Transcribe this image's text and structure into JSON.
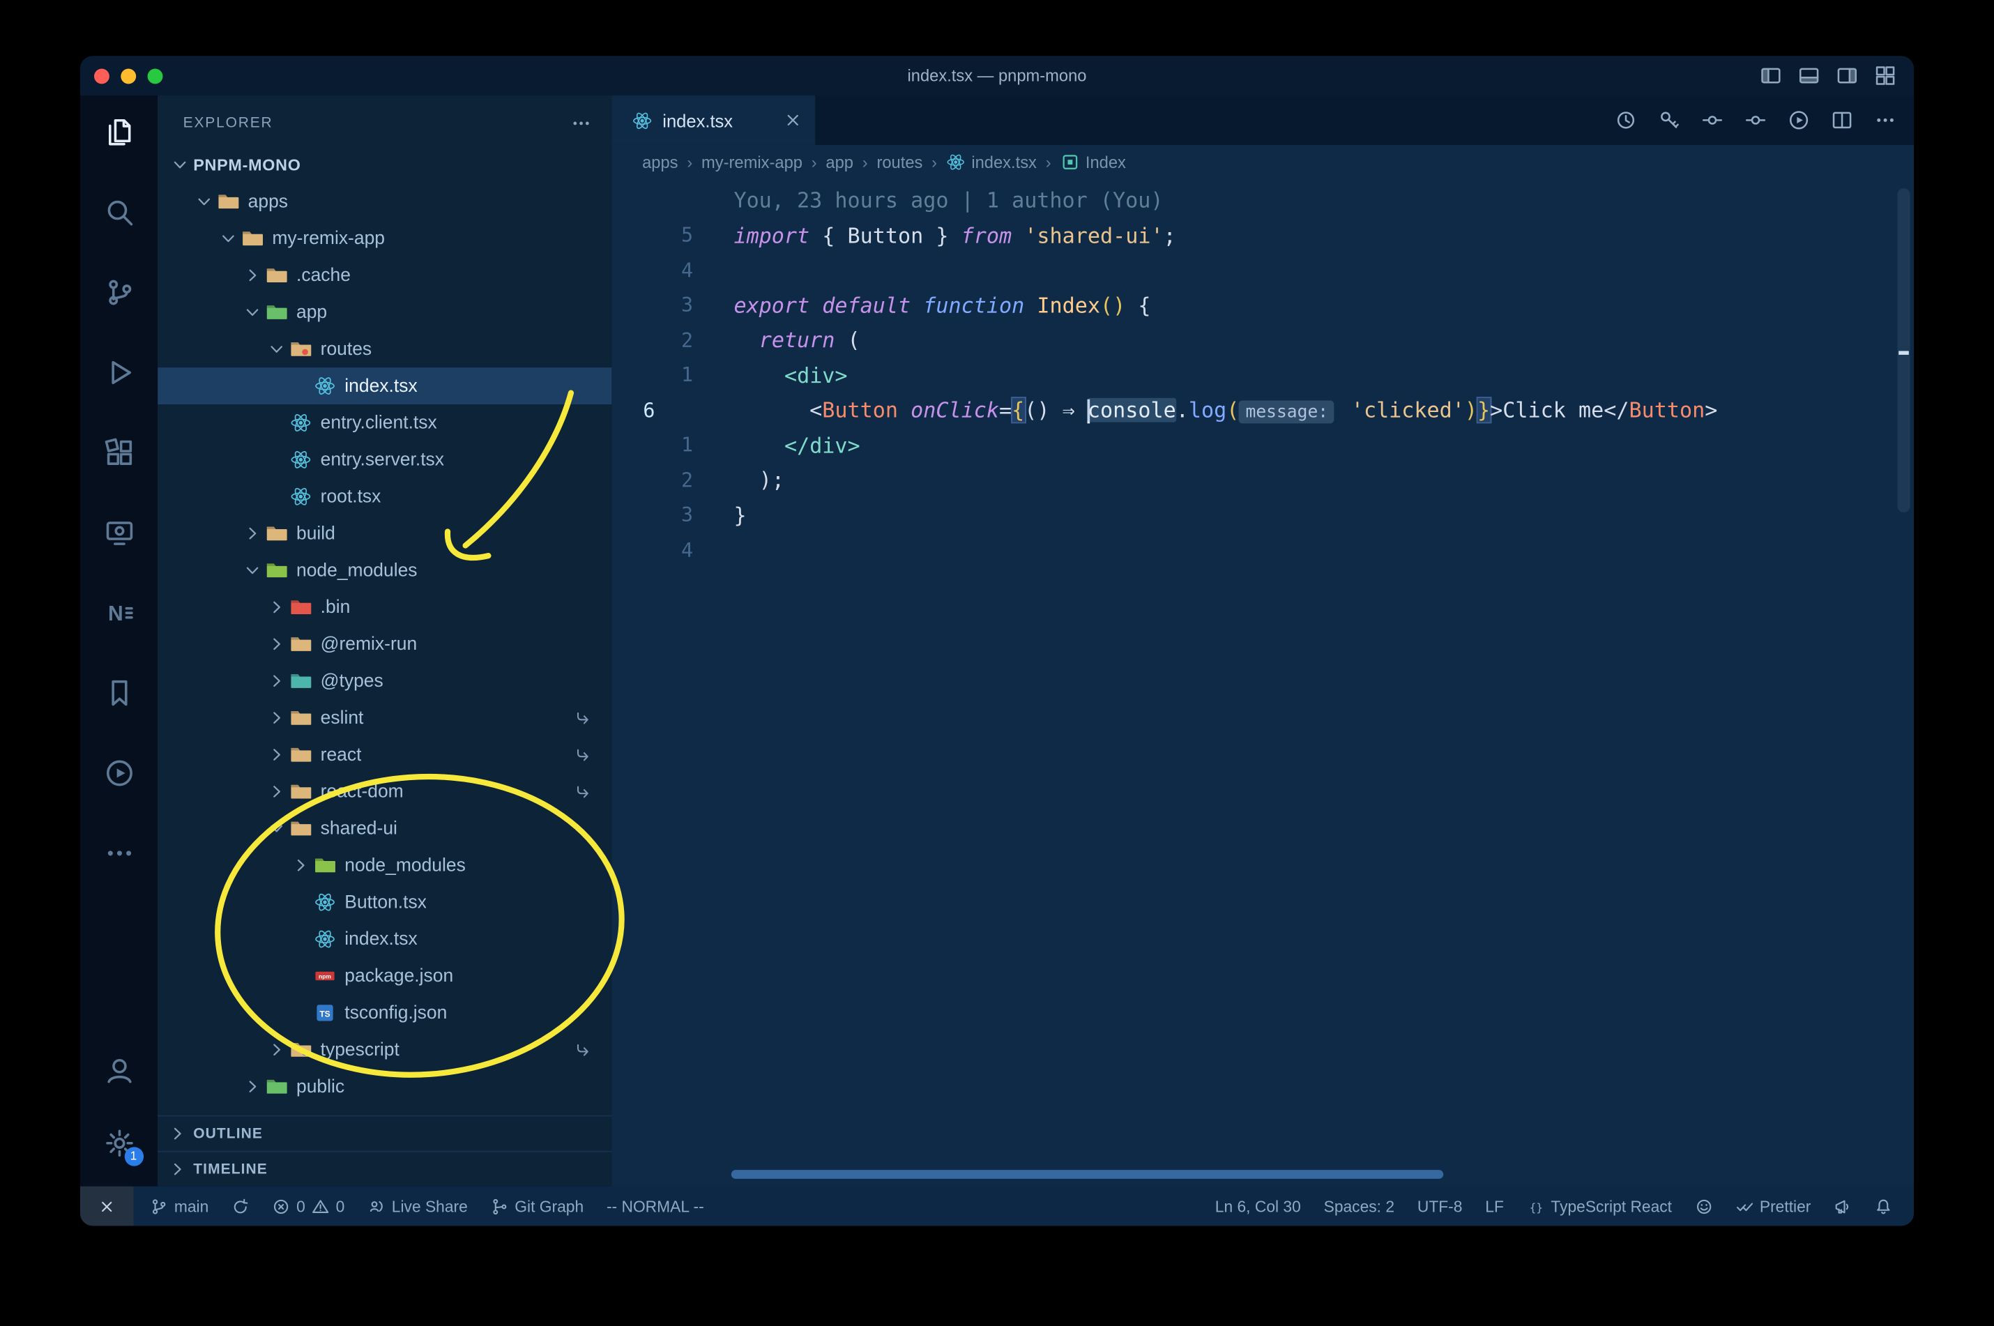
{
  "window": {
    "title": "index.tsx — pnpm-mono"
  },
  "titlebar": {
    "layout_controls": [
      {
        "name": "toggle-primary-sidebar",
        "icon": "layout-sidebar-left"
      },
      {
        "name": "toggle-panel",
        "icon": "layout-panel"
      },
      {
        "name": "toggle-secondary-sidebar",
        "icon": "layout-sidebar-right"
      },
      {
        "name": "customize-layout",
        "icon": "layout-grid"
      }
    ]
  },
  "activity_bar": {
    "top": [
      {
        "name": "explorer",
        "icon": "files",
        "active": true
      },
      {
        "name": "search",
        "icon": "search"
      },
      {
        "name": "source-control",
        "icon": "source-control"
      },
      {
        "name": "run-and-debug",
        "icon": "debug"
      },
      {
        "name": "extensions",
        "icon": "extensions"
      },
      {
        "name": "remote-explorer",
        "icon": "remote"
      },
      {
        "name": "nx-console",
        "icon": "nx"
      },
      {
        "name": "bookmarks",
        "icon": "bookmark"
      },
      {
        "name": "live-share",
        "icon": "play-circle"
      },
      {
        "name": "additional-views",
        "icon": "ellipsis"
      }
    ],
    "bottom": [
      {
        "name": "accounts",
        "icon": "account"
      },
      {
        "name": "settings",
        "icon": "gear",
        "badge": "1"
      }
    ]
  },
  "sidebar": {
    "header": "EXPLORER",
    "tree": [
      {
        "label": "PNPM-MONO",
        "depth": 0,
        "kind": "root",
        "expanded": true
      },
      {
        "label": "apps",
        "depth": 1,
        "kind": "folder",
        "color": "#dcb67a",
        "expanded": true
      },
      {
        "label": "my-remix-app",
        "depth": 2,
        "kind": "folder",
        "color": "#dcb67a",
        "expanded": true
      },
      {
        "label": ".cache",
        "depth": 3,
        "kind": "folder",
        "color": "#dcb67a",
        "expanded": false
      },
      {
        "label": "app",
        "depth": 3,
        "kind": "folder",
        "color": "#6abf69",
        "expanded": true
      },
      {
        "label": "routes",
        "depth": 4,
        "kind": "folder",
        "color": "#dcb67a",
        "dot": "#e45649",
        "expanded": true
      },
      {
        "label": "index.tsx",
        "depth": 5,
        "kind": "file",
        "icon": "react",
        "selected": true
      },
      {
        "label": "entry.client.tsx",
        "depth": 4,
        "kind": "file",
        "icon": "react"
      },
      {
        "label": "entry.server.tsx",
        "depth": 4,
        "kind": "file",
        "icon": "react"
      },
      {
        "label": "root.tsx",
        "depth": 4,
        "kind": "file",
        "icon": "react"
      },
      {
        "label": "build",
        "depth": 3,
        "kind": "folder",
        "color": "#dcb67a",
        "expanded": false
      },
      {
        "label": "node_modules",
        "depth": 3,
        "kind": "folder",
        "color": "#8bc34a",
        "expanded": true
      },
      {
        "label": ".bin",
        "depth": 4,
        "kind": "folder",
        "color": "#e45649",
        "expanded": false
      },
      {
        "label": "@remix-run",
        "depth": 4,
        "kind": "folder",
        "color": "#dcb67a",
        "expanded": false
      },
      {
        "label": "@types",
        "depth": 4,
        "kind": "folder",
        "color": "#4db6ac",
        "expanded": false
      },
      {
        "label": "eslint",
        "depth": 4,
        "kind": "folder",
        "color": "#dcb67a",
        "expanded": false,
        "symlink": true
      },
      {
        "label": "react",
        "depth": 4,
        "kind": "folder",
        "color": "#dcb67a",
        "expanded": false,
        "symlink": true
      },
      {
        "label": "react-dom",
        "depth": 4,
        "kind": "folder",
        "color": "#dcb67a",
        "expanded": false,
        "symlink": true
      },
      {
        "label": "shared-ui",
        "depth": 4,
        "kind": "folder",
        "color": "#dcb67a",
        "expanded": true
      },
      {
        "label": "node_modules",
        "depth": 5,
        "kind": "folder",
        "color": "#8bc34a",
        "expanded": false
      },
      {
        "label": "Button.tsx",
        "depth": 5,
        "kind": "file",
        "icon": "react"
      },
      {
        "label": "index.tsx",
        "depth": 5,
        "kind": "file",
        "icon": "react"
      },
      {
        "label": "package.json",
        "depth": 5,
        "kind": "file",
        "icon": "npm"
      },
      {
        "label": "tsconfig.json",
        "depth": 5,
        "kind": "file",
        "icon": "ts"
      },
      {
        "label": "typescript",
        "depth": 4,
        "kind": "folder",
        "color": "#dcb67a",
        "dot": "#3178c6",
        "expanded": false,
        "symlink": true
      },
      {
        "label": "public",
        "depth": 3,
        "kind": "folder",
        "color": "#6abf69",
        "expanded": false
      }
    ],
    "sections": [
      {
        "label": "OUTLINE"
      },
      {
        "label": "TIMELINE"
      }
    ]
  },
  "editor": {
    "tab": {
      "label": "index.tsx",
      "icon": "react"
    },
    "actions": [
      {
        "name": "local-history",
        "icon": "history"
      },
      {
        "name": "gitlens-annotations",
        "icon": "key"
      },
      {
        "name": "toggle-blame",
        "icon": "eye-line"
      },
      {
        "name": "toggle-heatmap",
        "icon": "eye-line"
      },
      {
        "name": "run-file",
        "icon": "run-circle"
      },
      {
        "name": "split-editor",
        "icon": "split"
      },
      {
        "name": "more-actions",
        "icon": "ellipsis"
      }
    ],
    "breadcrumbs": [
      {
        "label": "apps"
      },
      {
        "label": "my-remix-app"
      },
      {
        "label": "app"
      },
      {
        "label": "routes"
      },
      {
        "label": "index.tsx",
        "icon": "react"
      },
      {
        "label": "Index",
        "icon": "symbol"
      }
    ],
    "code_lines": [
      {
        "num": "",
        "cls": "blame",
        "tokens": [
          [
            "You, 23 hours ago | 1 author (You)",
            "dim"
          ]
        ]
      },
      {
        "num": "5",
        "tokens": [
          [
            "import",
            "kw"
          ],
          [
            " ",
            "pln"
          ],
          [
            "{",
            "pnc"
          ],
          [
            " ",
            "pln"
          ],
          [
            "Button",
            "var"
          ],
          [
            " ",
            "pln"
          ],
          [
            "}",
            "pnc"
          ],
          [
            " ",
            "pln"
          ],
          [
            "from",
            "kw"
          ],
          [
            " ",
            "pln"
          ],
          [
            "'shared-ui'",
            "str"
          ],
          [
            ";",
            "pnc"
          ]
        ]
      },
      {
        "num": "4",
        "tokens": []
      },
      {
        "num": "3",
        "tokens": [
          [
            "export",
            "kw"
          ],
          [
            " ",
            "pln"
          ],
          [
            "default",
            "kw"
          ],
          [
            " ",
            "pln"
          ],
          [
            "function",
            "kwf"
          ],
          [
            " ",
            "pln"
          ],
          [
            "Index",
            "fnm"
          ],
          [
            "()",
            "gld"
          ],
          [
            " ",
            "pln"
          ],
          [
            "{",
            "pnc"
          ]
        ]
      },
      {
        "num": "2",
        "tokens": [
          [
            "  ",
            "pln"
          ],
          [
            "return",
            "kw"
          ],
          [
            " ",
            "pln"
          ],
          [
            "(",
            "pnc"
          ]
        ]
      },
      {
        "num": "1",
        "tokens": [
          [
            "    ",
            "pln"
          ],
          [
            "<div>",
            "tag"
          ]
        ]
      },
      {
        "num": "6",
        "current": true,
        "tokens": [
          [
            "      ",
            "pln"
          ],
          [
            "<",
            "pnc"
          ],
          [
            "Button",
            "cmp"
          ],
          [
            " ",
            "pln"
          ],
          [
            "onClick",
            "att"
          ],
          [
            "=",
            "pnc"
          ],
          [
            "{",
            "bhl"
          ],
          [
            "()",
            "pnc"
          ],
          [
            " ",
            "pln"
          ],
          [
            "⇒",
            "pnc"
          ],
          [
            " ",
            "pln"
          ],
          [
            "",
            "crt"
          ],
          [
            "console",
            "wrd"
          ],
          [
            ".",
            "pnc"
          ],
          [
            "log",
            "fn"
          ],
          [
            "(",
            "gld"
          ],
          [
            "message:",
            "inl"
          ],
          [
            " ",
            "pln"
          ],
          [
            "'clicked'",
            "str"
          ],
          [
            ")",
            "gld"
          ],
          [
            "}",
            "bhl"
          ],
          [
            ">",
            "pnc"
          ],
          [
            "Click me",
            "pln"
          ],
          [
            "</",
            "pnc"
          ],
          [
            "Button",
            "cmp"
          ],
          [
            ">",
            "pnc"
          ]
        ]
      },
      {
        "num": "1",
        "tokens": [
          [
            "    ",
            "pln"
          ],
          [
            "</div>",
            "tag"
          ]
        ]
      },
      {
        "num": "2",
        "tokens": [
          [
            "  ",
            "pln"
          ],
          [
            ");",
            "pnc"
          ]
        ]
      },
      {
        "num": "3",
        "tokens": [
          [
            "}",
            "pnc"
          ]
        ]
      },
      {
        "num": "4",
        "tokens": []
      }
    ]
  },
  "status_bar": {
    "left": [
      {
        "name": "remote-indicator",
        "icon": "remote-x",
        "style": "remote"
      },
      {
        "name": "git-branch",
        "icon": "branch",
        "label": "main"
      },
      {
        "name": "sync-changes",
        "icon": "sync"
      },
      {
        "name": "problems",
        "parts": [
          {
            "icon": "error",
            "label": "0"
          },
          {
            "icon": "warning",
            "label": "0"
          }
        ]
      },
      {
        "name": "live-share",
        "icon": "live-share",
        "label": "Live Share"
      },
      {
        "name": "git-graph",
        "icon": "graph",
        "label": "Git Graph"
      },
      {
        "name": "vim-mode",
        "label": "-- NORMAL --"
      }
    ],
    "right": [
      {
        "name": "cursor-position",
        "label": "Ln 6, Col 30"
      },
      {
        "name": "indentation",
        "label": "Spaces: 2"
      },
      {
        "name": "encoding",
        "label": "UTF-8"
      },
      {
        "name": "eol",
        "label": "LF"
      },
      {
        "name": "language-mode",
        "icon": "braces",
        "label": "TypeScript React"
      },
      {
        "name": "feedback-smiley",
        "icon": "smiley"
      },
      {
        "name": "formatter-prettier",
        "icon": "double-check",
        "label": "Prettier"
      },
      {
        "name": "announcement",
        "icon": "megaphone"
      },
      {
        "name": "notifications",
        "icon": "bell"
      }
    ]
  },
  "colors": {
    "annotation_yellow": "#f7e93b",
    "editor_bg": "#0e2a47",
    "sidebar_bg": "#0d2337",
    "scrollbar_blue": "#35699f",
    "selection_row": "#1c3f63"
  }
}
